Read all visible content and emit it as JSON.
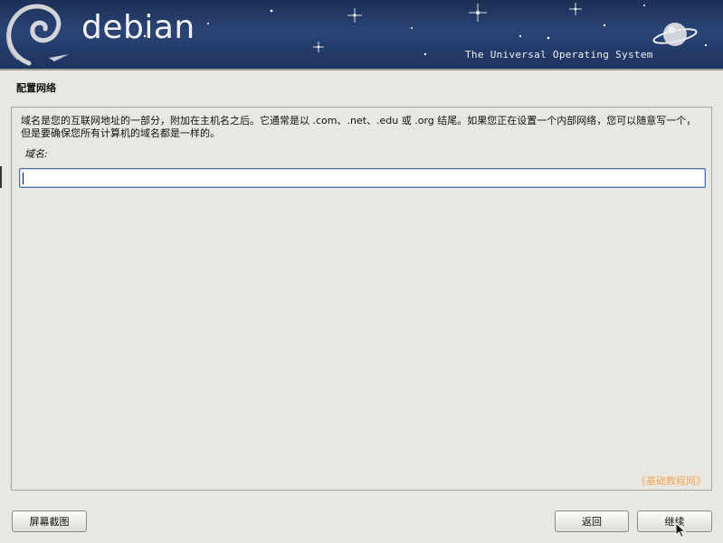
{
  "banner": {
    "brand": "debian",
    "tagline": "The Universal Operating System"
  },
  "page": {
    "title": "配置网络"
  },
  "main": {
    "description": "域名是您的互联网地址的一部分，附加在主机名之后。它通常是以 .com、.net、.edu 或 .org 结尾。如果您正在设置一个内部网络，您可以随意写一个，但是要确保您所有计算机的域名都是一样的。",
    "field_label": "域名:",
    "domain_value": "",
    "watermark": "《基础教程网》"
  },
  "buttons": {
    "screenshot": "屏幕截图",
    "back": "返回",
    "continue": "继续"
  },
  "icons": {
    "swirl": "debian-swirl-icon",
    "planet": "planet-icon",
    "cursor": "mouse-cursor-icon"
  },
  "colors": {
    "banner_bg": "#1e3360",
    "window_bg": "#e8e7e2",
    "input_border": "#4d6fa3",
    "watermark": "#f2a95e"
  }
}
